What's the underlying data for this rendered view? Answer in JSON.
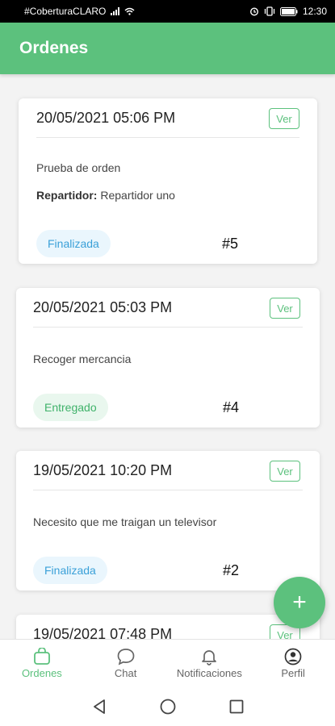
{
  "status_bar": {
    "carrier": "#CoberturaCLARO",
    "time": "12:30",
    "battery_icon": "battery-icon",
    "alarm_icon": "alarm-icon",
    "vibrate_icon": "vibrate-icon",
    "wifi_icon": "wifi-icon",
    "signal_icon": "signal-icon"
  },
  "app_bar": {
    "title": "Ordenes"
  },
  "orders": [
    {
      "date": "20/05/2021 05:06 PM",
      "view_label": "Ver",
      "description": "Prueba de orden",
      "driver_label": "Repartidor:",
      "driver_name": "Repartidor uno",
      "status": "Finalizada",
      "number": "#5"
    },
    {
      "date": "20/05/2021 05:03 PM",
      "view_label": "Ver",
      "description": "Recoger mercancia",
      "status": "Entregado",
      "number": "#4"
    },
    {
      "date": "19/05/2021 10:20 PM",
      "view_label": "Ver",
      "description": "Necesito que me traigan un televisor",
      "status": "Finalizada",
      "number": "#2"
    },
    {
      "date": "19/05/2021 07:48 PM",
      "view_label": "Ver"
    }
  ],
  "fab": {
    "label": "+"
  },
  "bottom_nav": [
    {
      "label": "Ordenes",
      "icon": "bag-icon",
      "active": true
    },
    {
      "label": "Chat",
      "icon": "chat-bubble-icon",
      "active": false
    },
    {
      "label": "Notificaciones",
      "icon": "bell-icon",
      "active": false
    },
    {
      "label": "Perfil",
      "icon": "user-circle-icon",
      "active": false
    }
  ],
  "colors": {
    "primary": "#5cc17d",
    "finalizada": "#3aa0d8",
    "entregado": "#3fb26a"
  }
}
